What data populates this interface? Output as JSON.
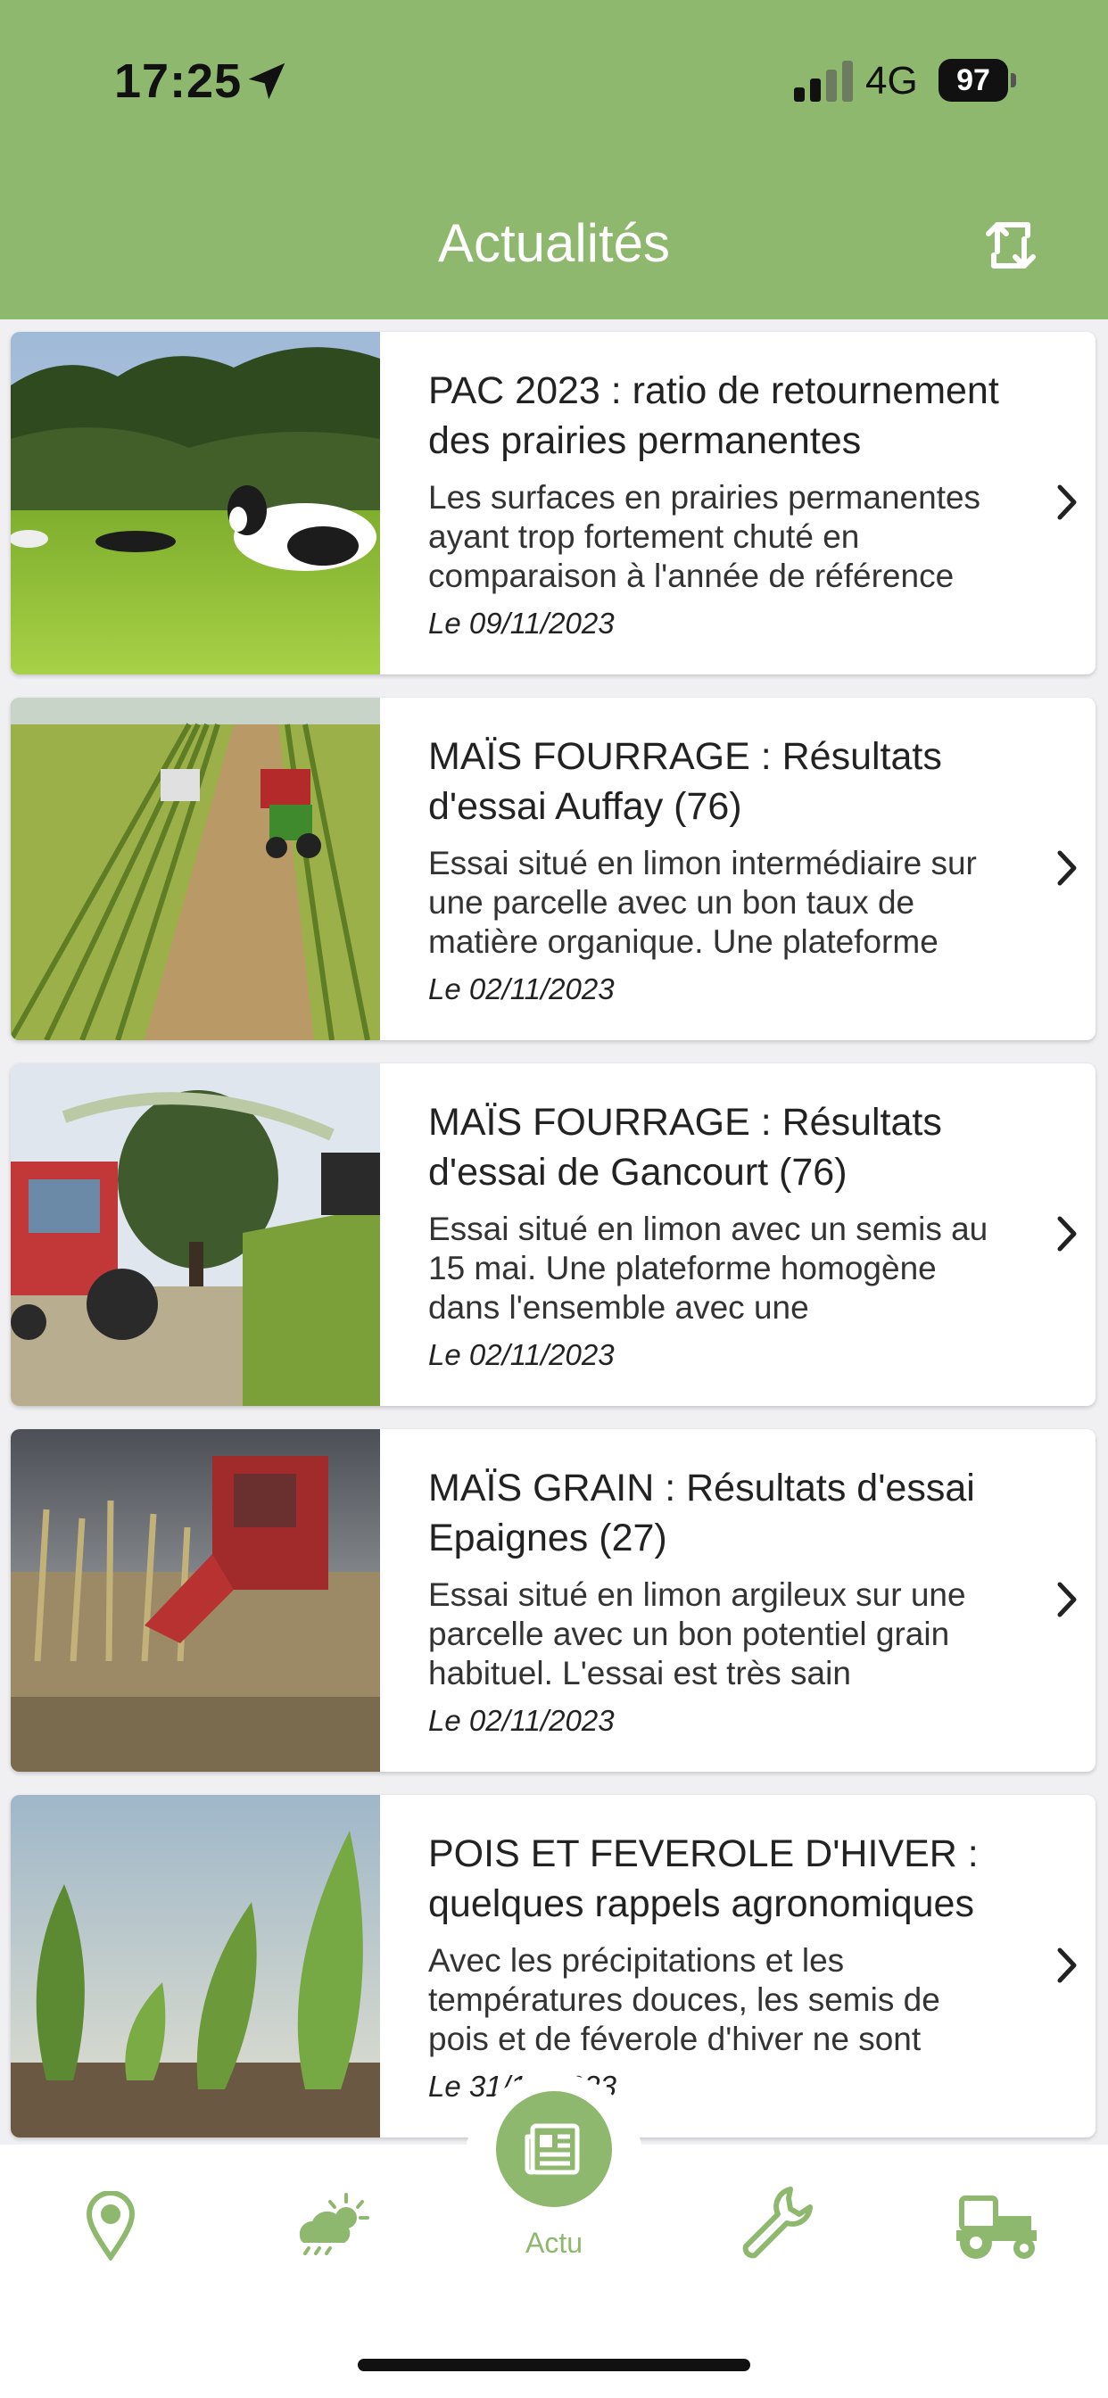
{
  "status_bar": {
    "time": "17:25",
    "network": "4G",
    "battery": "97"
  },
  "header": {
    "title": "Actualités"
  },
  "articles": [
    {
      "title": "PAC 2023 : ratio de retournement des prairies permanentes",
      "excerpt": "Les surfaces en prairies permanentes ayant trop fortement chuté en comparaison à l'année de référence",
      "date": "Le 09/11/2023"
    },
    {
      "title": "MAÏS FOURRAGE : Résultats d'essai Auffay (76)",
      "excerpt": "Essai situé en limon intermédiaire sur une parcelle avec un bon taux de matière organique. Une plateforme",
      "date": "Le 02/11/2023"
    },
    {
      "title": "MAÏS FOURRAGE : Résultats d'essai de Gancourt (76)",
      "excerpt": "Essai situé en limon avec un semis au 15 mai. Une plateforme homogène dans l'ensemble avec une",
      "date": "Le 02/11/2023"
    },
    {
      "title": "MAÏS GRAIN : Résultats d'essai Epaignes (27)",
      "excerpt": "Essai situé en limon argileux sur une parcelle avec un bon potentiel grain habituel. L'essai est très sain",
      "date": "Le 02/11/2023"
    },
    {
      "title": "POIS ET FEVEROLE D'HIVER : quelques rappels agronomiques",
      "excerpt": "Avec les précipitations et les températures douces, les semis de pois et de féverole d'hiver ne sont",
      "date": "Le 31/10/2023"
    }
  ],
  "tabbar": {
    "items": [
      {
        "icon": "map-pin-icon"
      },
      {
        "icon": "weather-icon"
      },
      {
        "icon": "news-icon",
        "label": "Actu",
        "active": true
      },
      {
        "icon": "wrench-icon"
      },
      {
        "icon": "tractor-icon"
      }
    ]
  },
  "colors": {
    "accent": "#8fb86f",
    "background": "#f0f0f2"
  }
}
